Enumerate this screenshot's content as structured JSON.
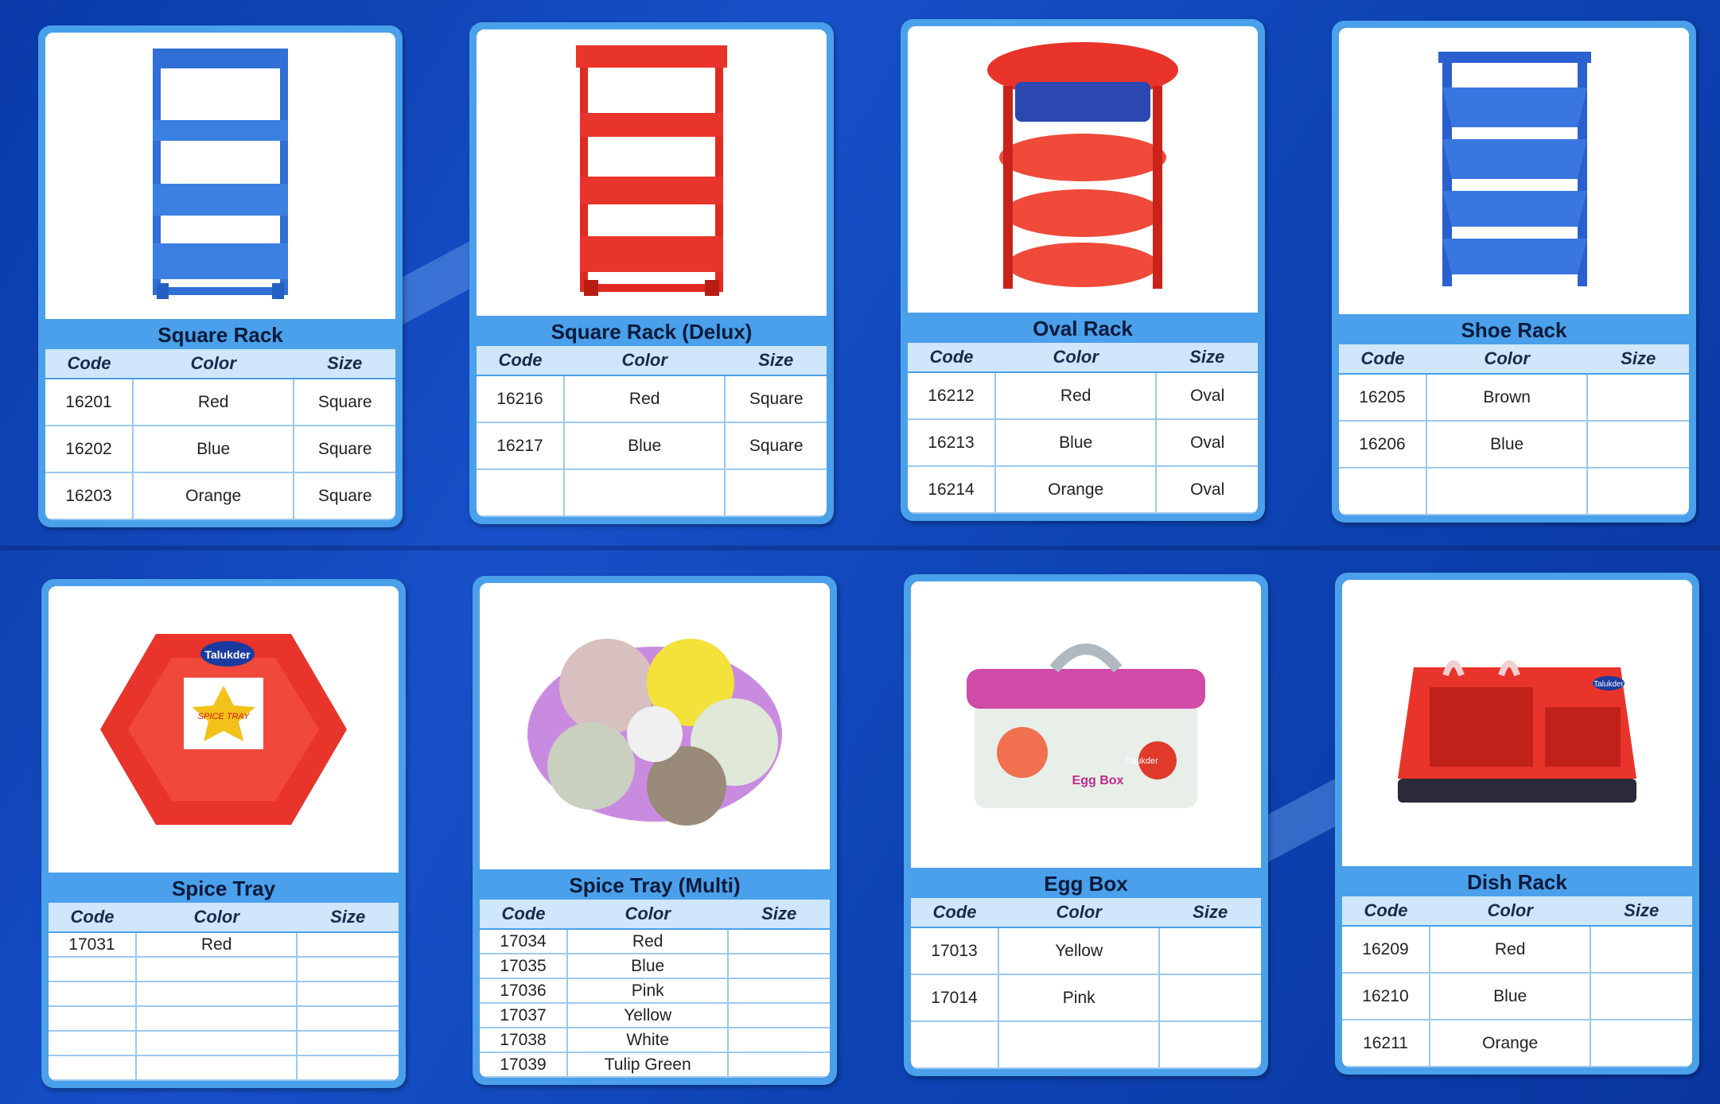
{
  "products": [
    {
      "id": "square-rack",
      "title": "Square Rack",
      "columns": [
        "Code",
        "Color",
        "Size"
      ],
      "rows": [
        [
          "16201",
          "Red",
          "Square"
        ],
        [
          "16202",
          "Blue",
          "Square"
        ],
        [
          "16203",
          "Orange",
          "Square"
        ]
      ],
      "row_count": 3
    },
    {
      "id": "square-rack-delux",
      "title": "Square Rack (Delux)",
      "columns": [
        "Code",
        "Color",
        "Size"
      ],
      "rows": [
        [
          "16216",
          "Red",
          "Square"
        ],
        [
          "16217",
          "Blue",
          "Square"
        ],
        [
          "",
          "",
          ""
        ]
      ],
      "row_count": 3
    },
    {
      "id": "oval-rack",
      "title": "Oval Rack",
      "columns": [
        "Code",
        "Color",
        "Size"
      ],
      "rows": [
        [
          "16212",
          "Red",
          "Oval"
        ],
        [
          "16213",
          "Blue",
          "Oval"
        ],
        [
          "16214",
          "Orange",
          "Oval"
        ]
      ],
      "row_count": 3
    },
    {
      "id": "shoe-rack",
      "title": "Shoe Rack",
      "columns": [
        "Code",
        "Color",
        "Size"
      ],
      "rows": [
        [
          "16205",
          "Brown",
          ""
        ],
        [
          "16206",
          "Blue",
          ""
        ],
        [
          "",
          "",
          ""
        ]
      ],
      "row_count": 3
    },
    {
      "id": "spice-tray",
      "title": "Spice Tray",
      "columns": [
        "Code",
        "Color",
        "Size"
      ],
      "rows": [
        [
          "17031",
          "Red",
          ""
        ],
        [
          "",
          "",
          ""
        ],
        [
          "",
          "",
          ""
        ],
        [
          "",
          "",
          ""
        ],
        [
          "",
          "",
          ""
        ],
        [
          "",
          "",
          ""
        ]
      ],
      "row_count": 6
    },
    {
      "id": "spice-tray-multi",
      "title": "Spice Tray (Multi)",
      "columns": [
        "Code",
        "Color",
        "Size"
      ],
      "rows": [
        [
          "17034",
          "Red",
          ""
        ],
        [
          "17035",
          "Blue",
          ""
        ],
        [
          "17036",
          "Pink",
          ""
        ],
        [
          "17037",
          "Yellow",
          ""
        ],
        [
          "17038",
          "White",
          ""
        ],
        [
          "17039",
          "Tulip Green",
          ""
        ]
      ],
      "row_count": 6
    },
    {
      "id": "egg-box",
      "title": "Egg Box",
      "columns": [
        "Code",
        "Color",
        "Size"
      ],
      "rows": [
        [
          "17013",
          "Yellow",
          ""
        ],
        [
          "17014",
          "Pink",
          ""
        ],
        [
          "",
          "",
          ""
        ]
      ],
      "row_count": 3
    },
    {
      "id": "dish-rack",
      "title": "Dish Rack",
      "columns": [
        "Code",
        "Color",
        "Size"
      ],
      "rows": [
        [
          "16209",
          "Red",
          ""
        ],
        [
          "16210",
          "Blue",
          ""
        ],
        [
          "16211",
          "Orange",
          ""
        ]
      ],
      "row_count": 3
    }
  ],
  "image_labels": {
    "brand": "Talukder",
    "spice_badge": "SPICE TRAY",
    "egg_label": "Egg Box"
  },
  "colors": {
    "card_blue": "#4aa0ea",
    "background_blue": "#1750c8",
    "header_light": "#cfe6fb"
  }
}
